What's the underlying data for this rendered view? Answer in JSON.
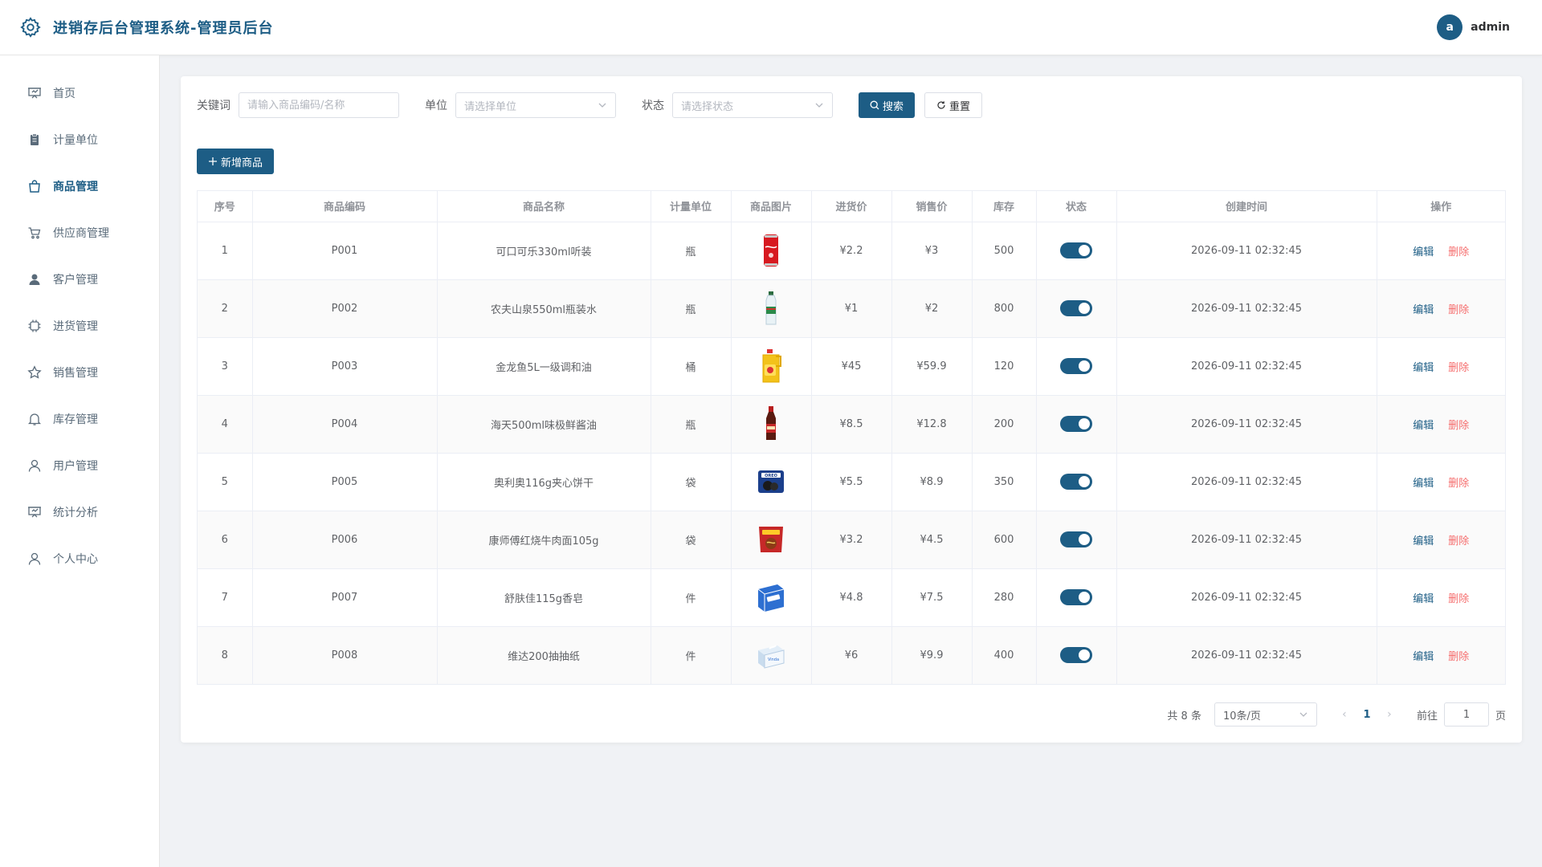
{
  "app": {
    "title": "进销存后台管理系统-管理员后台",
    "user": {
      "avatar_letter": "a",
      "name": "admin"
    }
  },
  "sidebar": {
    "items": [
      {
        "label": "首页",
        "icon": "presentation-icon"
      },
      {
        "label": "计量单位",
        "icon": "clipboard-icon"
      },
      {
        "label": "商品管理",
        "icon": "shopping-bag-icon",
        "active": true
      },
      {
        "label": "供应商管理",
        "icon": "cart-icon"
      },
      {
        "label": "客户管理",
        "icon": "user-filled-icon"
      },
      {
        "label": "进货管理",
        "icon": "cpu-icon"
      },
      {
        "label": "销售管理",
        "icon": "star-icon"
      },
      {
        "label": "库存管理",
        "icon": "bell-icon"
      },
      {
        "label": "用户管理",
        "icon": "user-icon"
      },
      {
        "label": "统计分析",
        "icon": "presentation-icon"
      },
      {
        "label": "个人中心",
        "icon": "user-icon"
      }
    ]
  },
  "filters": {
    "keyword_label": "关键词",
    "keyword_placeholder": "请输入商品编码/名称",
    "unit_label": "单位",
    "unit_placeholder": "请选择单位",
    "status_label": "状态",
    "status_placeholder": "请选择状态",
    "search_label": "搜索",
    "reset_label": "重置"
  },
  "toolbar": {
    "add_label": "新增商品"
  },
  "table": {
    "columns": [
      "序号",
      "商品编码",
      "商品名称",
      "计量单位",
      "商品图片",
      "进货价",
      "销售价",
      "库存",
      "状态",
      "创建时间",
      "操作"
    ],
    "edit_label": "编辑",
    "delete_label": "删除",
    "rows": [
      {
        "no": "1",
        "code": "P001",
        "name": "可口可乐330ml听装",
        "unit": "瓶",
        "image": "cola-can",
        "cost": "¥2.2",
        "price": "¥3",
        "stock": "500",
        "enabled": true,
        "created": "2026-09-11 02:32:45"
      },
      {
        "no": "2",
        "code": "P002",
        "name": "农夫山泉550ml瓶装水",
        "unit": "瓶",
        "image": "water-bottle",
        "cost": "¥1",
        "price": "¥2",
        "stock": "800",
        "enabled": true,
        "created": "2026-09-11 02:32:45"
      },
      {
        "no": "3",
        "code": "P003",
        "name": "金龙鱼5L一级调和油",
        "unit": "桶",
        "image": "oil-jug",
        "cost": "¥45",
        "price": "¥59.9",
        "stock": "120",
        "enabled": true,
        "created": "2026-09-11 02:32:45"
      },
      {
        "no": "4",
        "code": "P004",
        "name": "海天500ml味极鲜酱油",
        "unit": "瓶",
        "image": "soy-sauce",
        "cost": "¥8.5",
        "price": "¥12.8",
        "stock": "200",
        "enabled": true,
        "created": "2026-09-11 02:32:45"
      },
      {
        "no": "5",
        "code": "P005",
        "name": "奥利奥116g夹心饼干",
        "unit": "袋",
        "image": "oreo-pack",
        "cost": "¥5.5",
        "price": "¥8.9",
        "stock": "350",
        "enabled": true,
        "created": "2026-09-11 02:32:45"
      },
      {
        "no": "6",
        "code": "P006",
        "name": "康师傅红烧牛肉面105g",
        "unit": "袋",
        "image": "noodle-pack",
        "cost": "¥3.2",
        "price": "¥4.5",
        "stock": "600",
        "enabled": true,
        "created": "2026-09-11 02:32:45"
      },
      {
        "no": "7",
        "code": "P007",
        "name": "舒肤佳115g香皂",
        "unit": "件",
        "image": "soap-box",
        "cost": "¥4.8",
        "price": "¥7.5",
        "stock": "280",
        "enabled": true,
        "created": "2026-09-11 02:32:45"
      },
      {
        "no": "8",
        "code": "P008",
        "name": "维达200抽抽纸",
        "unit": "件",
        "image": "tissue-box",
        "cost": "¥6",
        "price": "¥9.9",
        "stock": "400",
        "enabled": true,
        "created": "2026-09-11 02:32:45"
      }
    ]
  },
  "pagination": {
    "total_text": "共 8 条",
    "page_size": "10条/页",
    "current_page": "1",
    "goto_label": "前往",
    "goto_value": "1",
    "page_suffix": "页"
  },
  "colors": {
    "primary": "#1d5d85",
    "danger": "#f56c6c"
  }
}
